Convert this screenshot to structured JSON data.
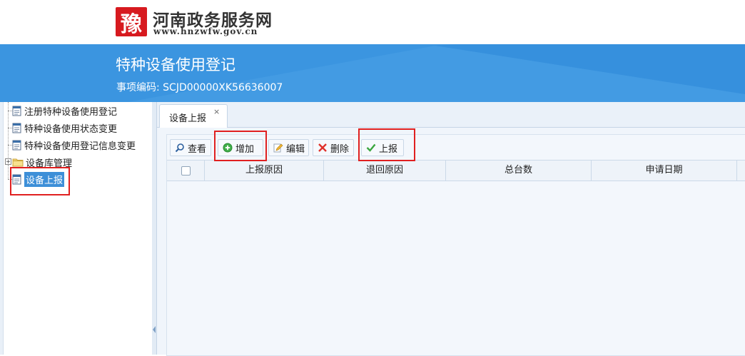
{
  "header": {
    "logo_glyph": "豫",
    "site_name": "河南政务服务网",
    "site_url": "www.hnzwfw.gov.cn"
  },
  "banner": {
    "title": "特种设备使用登记",
    "item_code": "事项编码: SCJD00000XK56636007"
  },
  "tree": {
    "items": [
      {
        "label": "注册特种设备使用登记",
        "icon": "document-icon"
      },
      {
        "label": "特种设备使用状态变更",
        "icon": "document-icon"
      },
      {
        "label": "特种设备使用登记信息变更",
        "icon": "document-icon"
      },
      {
        "label": "设备库管理",
        "icon": "folder-icon",
        "expander": "+"
      },
      {
        "label": "设备上报",
        "icon": "document-icon",
        "selected": true
      }
    ]
  },
  "tabs": [
    {
      "label": "设备上报",
      "close": "×"
    }
  ],
  "toolbar": {
    "view_label": "查看",
    "add_label": "增加",
    "edit_label": "编辑",
    "delete_label": "删除",
    "report_label": "上报"
  },
  "grid": {
    "columns": [
      "上报原因",
      "退回原因",
      "总台数",
      "申请日期"
    ],
    "rows": []
  },
  "colors": {
    "banner": "#3b95e0",
    "selected": "#3d8fd8",
    "highlight": "#e02020"
  }
}
